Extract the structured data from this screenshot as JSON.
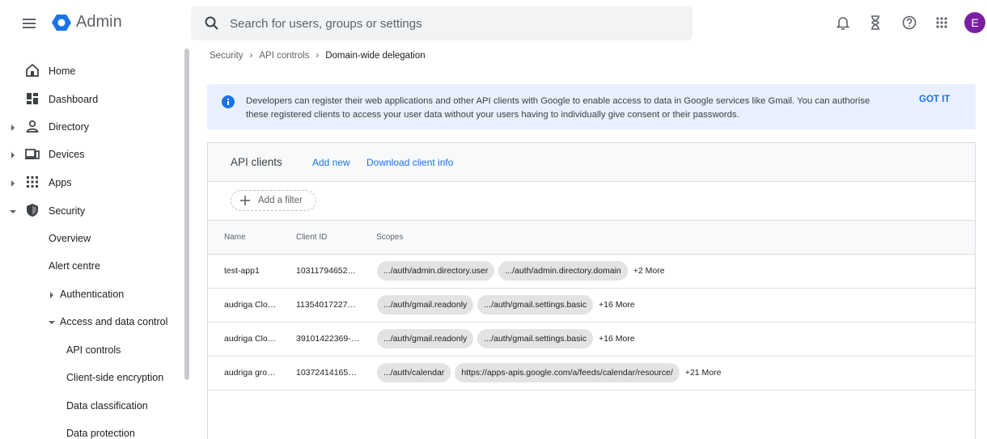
{
  "header": {
    "app_name": "Admin",
    "search_placeholder": "Search for users, groups or settings",
    "avatar_letter": "E"
  },
  "colors": {
    "accent": "#1a73e8",
    "avatar": "#7b1fa2",
    "banner_bg": "#e8f0fe"
  },
  "sidebar": {
    "items": [
      {
        "label": "Home",
        "icon": "home-icon"
      },
      {
        "label": "Dashboard",
        "icon": "dashboard-icon"
      },
      {
        "label": "Directory",
        "icon": "person-icon"
      },
      {
        "label": "Devices",
        "icon": "devices-icon"
      },
      {
        "label": "Apps",
        "icon": "apps-grid-icon"
      },
      {
        "label": "Security",
        "icon": "shield-icon"
      },
      {
        "label": "Overview"
      },
      {
        "label": "Alert centre"
      },
      {
        "label": "Authentication"
      },
      {
        "label": "Access and data control"
      },
      {
        "label": "API controls"
      },
      {
        "label": "Client-side encryption"
      },
      {
        "label": "Data classification"
      },
      {
        "label": "Data protection"
      }
    ]
  },
  "breadcrumb": {
    "items": [
      "Security",
      "API controls",
      "Domain-wide delegation"
    ]
  },
  "banner": {
    "text": "Developers can register their web applications and other API clients with Google to enable access to data in Google services like Gmail. You can authorise these registered clients to access your user data without your users having to individually give consent or their passwords.",
    "action": "GOT IT"
  },
  "card": {
    "title": "API clients",
    "add_new": "Add new",
    "download": "Download client info",
    "filter_label": "Add a filter"
  },
  "table": {
    "columns": [
      "Name",
      "Client ID",
      "Scopes"
    ],
    "rows": [
      {
        "name": "test-app1",
        "client_id": "10311794652…",
        "scopes": [
          ".../auth/admin.directory.user",
          ".../auth/admin.directory.domain"
        ],
        "more": "+2 More"
      },
      {
        "name": "audriga Clo…",
        "client_id": "11354017227…",
        "scopes": [
          ".../auth/gmail.readonly",
          ".../auth/gmail.settings.basic"
        ],
        "more": "+16 More"
      },
      {
        "name": "audriga Clo…",
        "client_id": "39101422369-…",
        "scopes": [
          ".../auth/gmail.readonly",
          ".../auth/gmail.settings.basic"
        ],
        "more": "+16 More"
      },
      {
        "name": "audriga gro…",
        "client_id": "10372414165…",
        "scopes": [
          ".../auth/calendar",
          "https://apps-apis.google.com/a/feeds/calendar/resource/"
        ],
        "more": "+21 More"
      }
    ]
  }
}
